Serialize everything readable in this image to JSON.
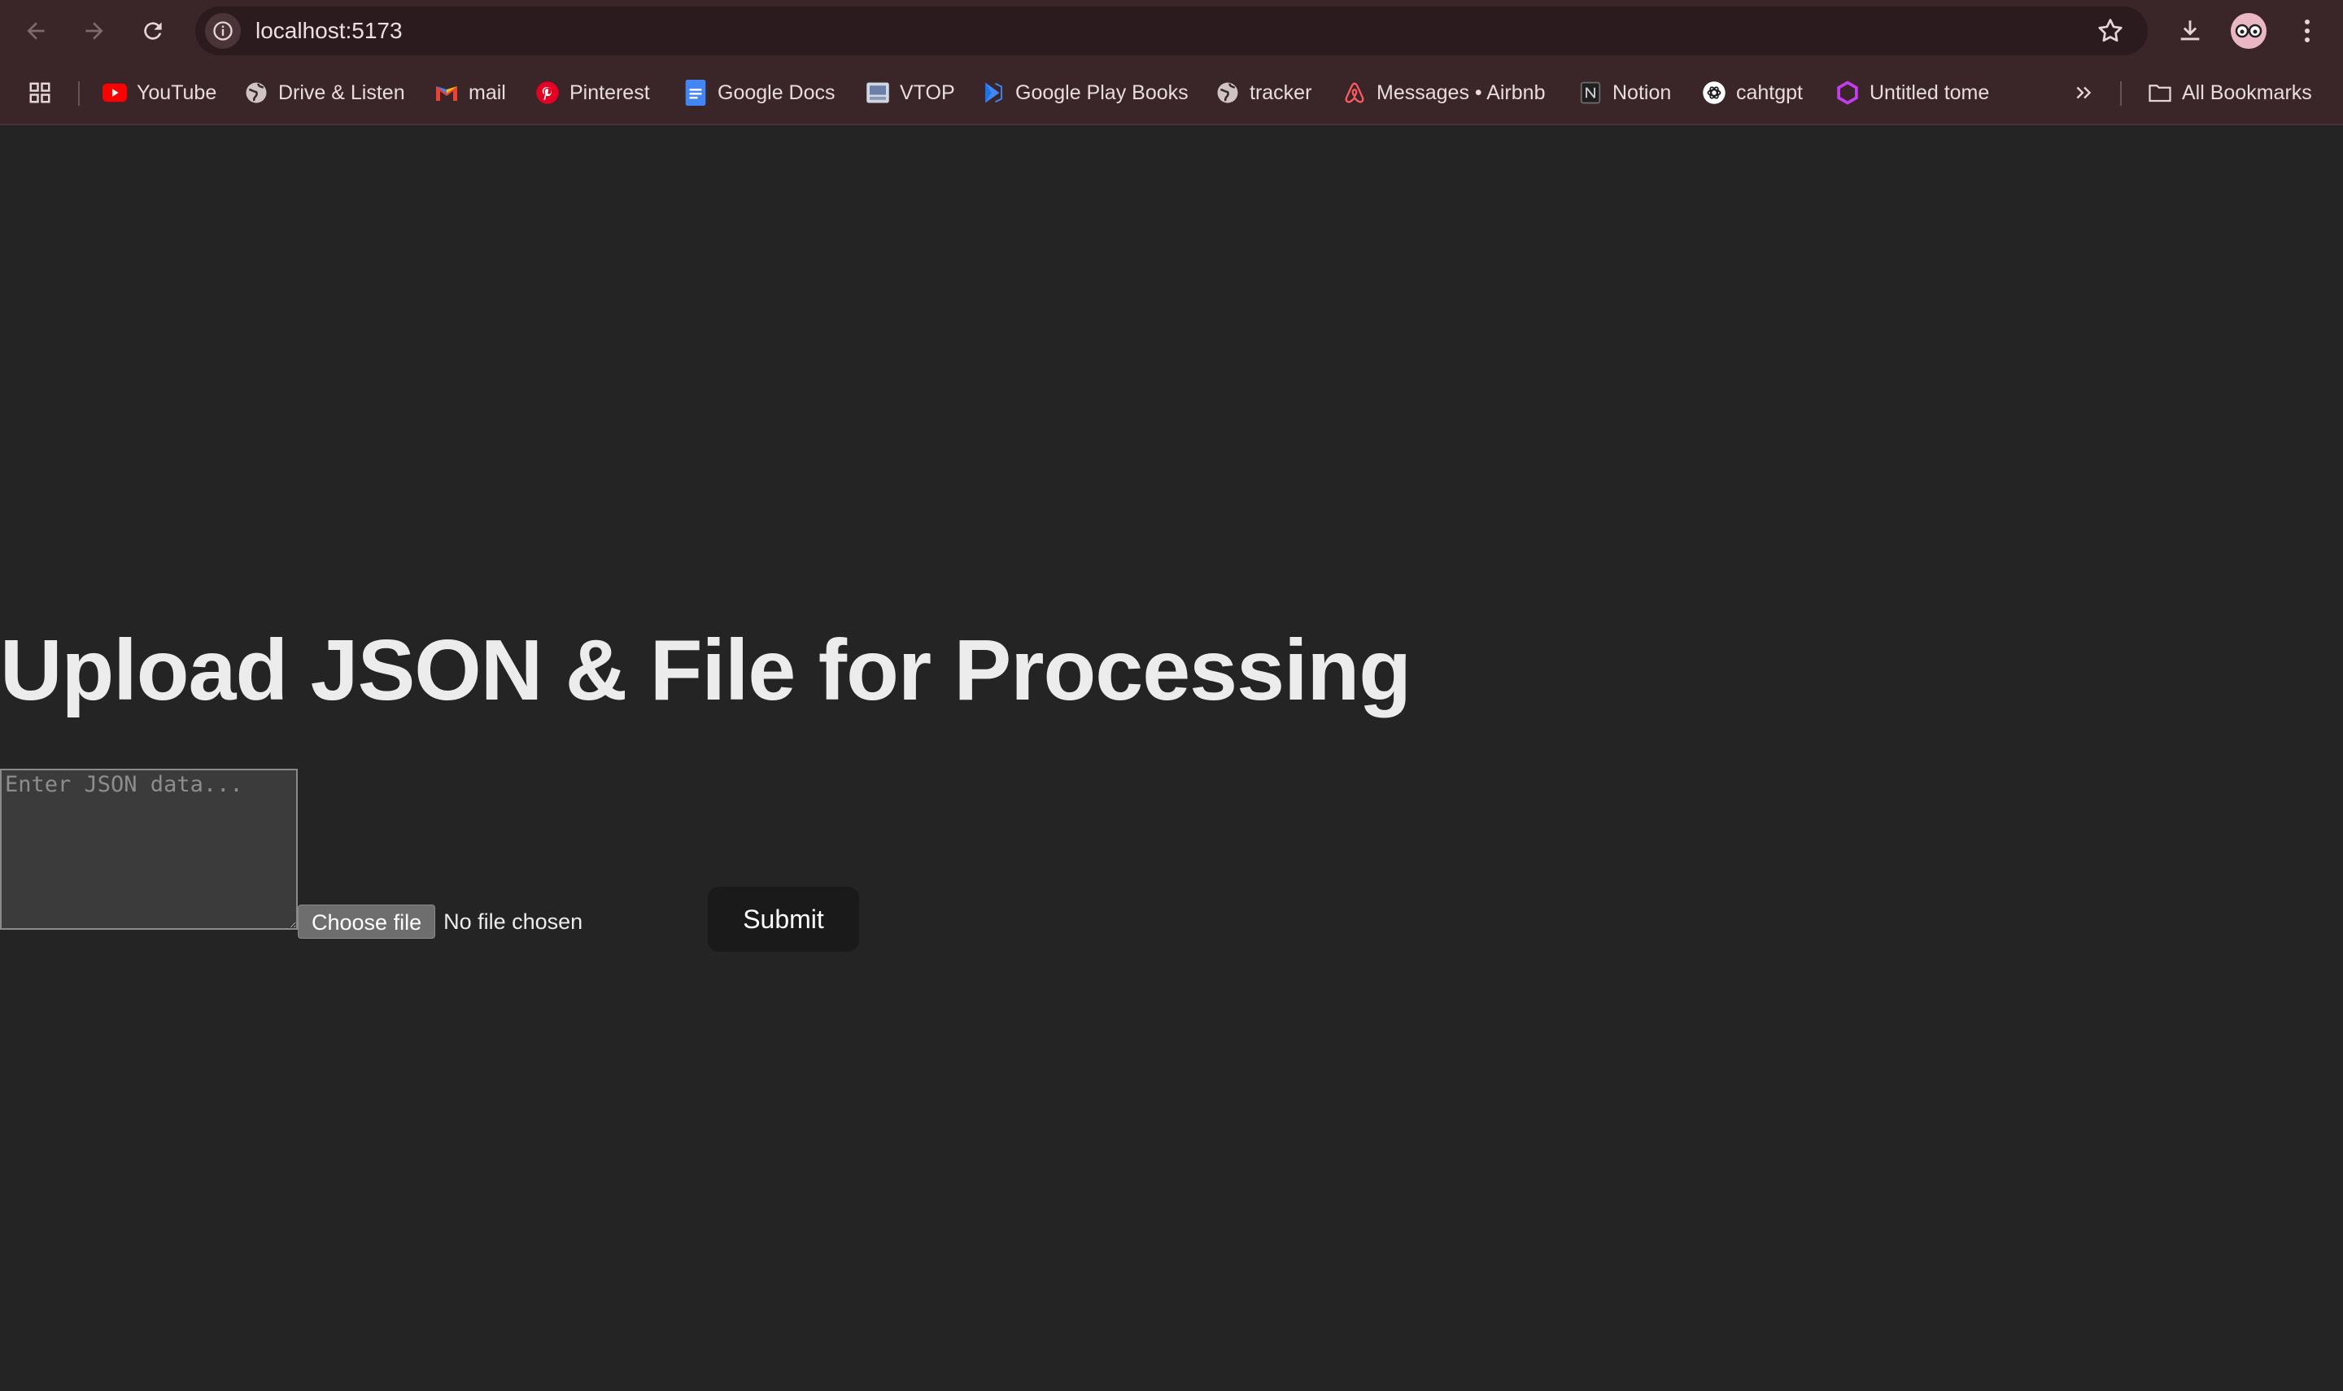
{
  "browser": {
    "url": "localhost:5173",
    "bookmarks": [
      {
        "label": "YouTube",
        "icon": "youtube-icon",
        "color": "#ff0000"
      },
      {
        "label": "Drive & Listen",
        "icon": "globe-icon",
        "color": "#cfc3c4"
      },
      {
        "label": "mail",
        "icon": "gmail-icon",
        "color": "#ea4335"
      },
      {
        "label": "Pinterest",
        "icon": "pinterest-icon",
        "color": "#e60023"
      },
      {
        "label": "Google Docs",
        "icon": "google-docs-icon",
        "color": "#4285f4"
      },
      {
        "label": "VTOP",
        "icon": "vtop-icon",
        "color": "#cfd6e4"
      },
      {
        "label": "Google Play Books",
        "icon": "play-books-icon",
        "color": "#4285f4"
      },
      {
        "label": "tracker",
        "icon": "globe-icon",
        "color": "#cfc3c4"
      },
      {
        "label": "Messages • Airbnb",
        "icon": "airbnb-icon",
        "color": "#ff5a5f"
      },
      {
        "label": "Notion",
        "icon": "notion-icon",
        "color": "#1f1f1f"
      },
      {
        "label": "cahtgpt",
        "icon": "chatgpt-icon",
        "color": "#ffffff"
      },
      {
        "label": "Untitled tome",
        "icon": "tome-icon",
        "color": "#c43cf0"
      }
    ],
    "all_bookmarks_label": "All Bookmarks"
  },
  "page": {
    "title": "Upload JSON & File for Processing",
    "json_placeholder": "Enter JSON data...",
    "choose_file_label": "Choose file",
    "no_file_text": "No file chosen",
    "submit_label": "Submit"
  }
}
